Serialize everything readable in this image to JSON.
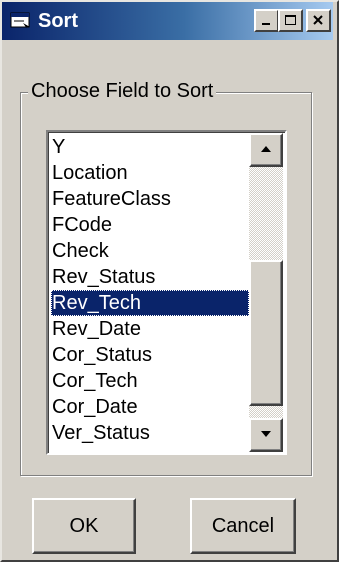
{
  "window": {
    "title": "Sort",
    "title_bar_colors": {
      "start": "#0a246a",
      "end": "#a6caf0"
    }
  },
  "title_buttons": {
    "minimize_icon": "minimize-icon",
    "maximize_icon": "maximize-icon",
    "close_icon": "close-icon"
  },
  "group": {
    "label": "Choose Field to Sort"
  },
  "listbox": {
    "items": [
      "Y",
      "Location",
      "FeatureClass",
      "FCode",
      "Check",
      "Rev_Status",
      "Rev_Tech",
      "Rev_Date",
      "Cor_Status",
      "Cor_Tech",
      "Cor_Date",
      "Ver_Status"
    ],
    "selected": "Rev_Tech",
    "selection_color": "#0a246a"
  },
  "scrollbar": {
    "up_icon": "scroll-up-arrow-icon",
    "down_icon": "scroll-down-arrow-icon"
  },
  "buttons": {
    "ok": "OK",
    "cancel": "Cancel"
  }
}
